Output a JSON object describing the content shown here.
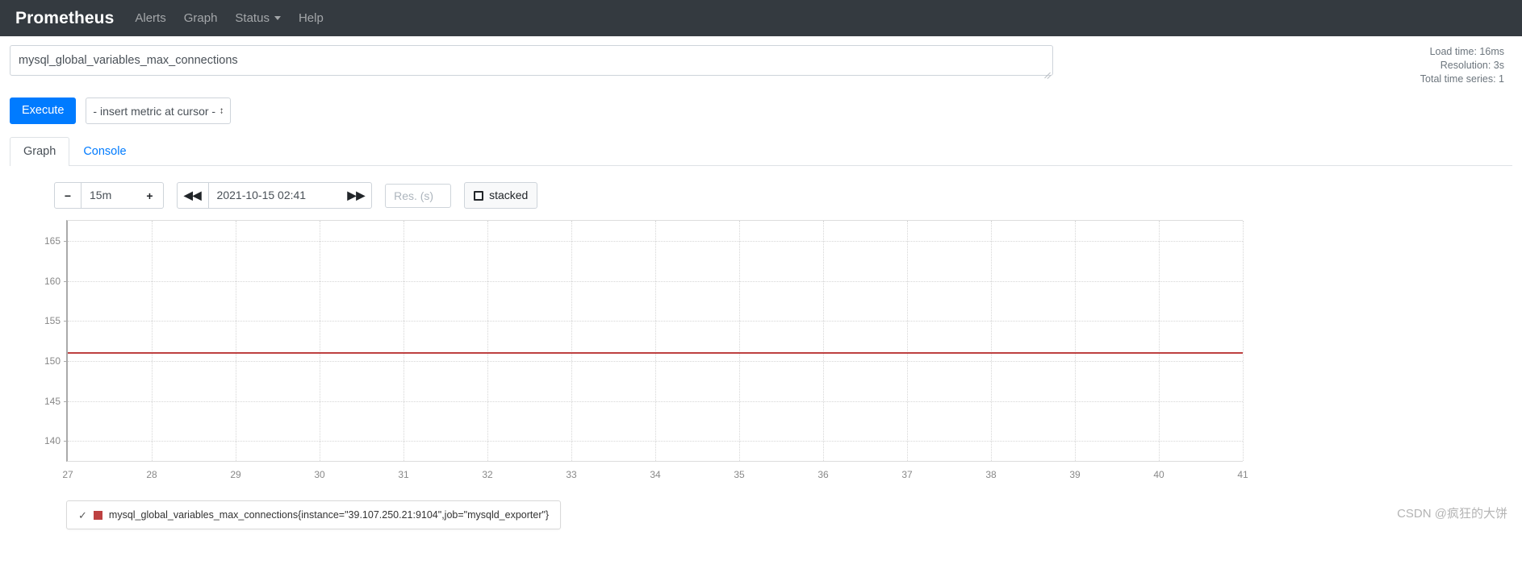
{
  "navbar": {
    "brand": "Prometheus",
    "links": [
      {
        "label": "Alerts",
        "has_caret": false
      },
      {
        "label": "Graph",
        "has_caret": false
      },
      {
        "label": "Status",
        "has_caret": true
      },
      {
        "label": "Help",
        "has_caret": false
      }
    ]
  },
  "query": {
    "expression": "mysql_global_variables_max_connections",
    "execute_label": "Execute",
    "metric_select_value": "- insert metric at cursor -"
  },
  "stats": {
    "load_time": "Load time: 16ms",
    "resolution": "Resolution: 3s",
    "total_series": "Total time series: 1"
  },
  "tabs": [
    {
      "label": "Graph",
      "active": true
    },
    {
      "label": "Console",
      "active": false
    }
  ],
  "graph_controls": {
    "decrease_label": "−",
    "range_value": "15m",
    "increase_label": "+",
    "back_label": "◀◀",
    "time_value": "2021-10-15 02:41",
    "forward_label": "▶▶",
    "resolution_placeholder": "Res. (s)",
    "resolution_value": "",
    "stacked_label": "stacked",
    "stacked_checked": false
  },
  "chart_data": {
    "type": "line",
    "title": "",
    "xlabel": "",
    "ylabel": "",
    "x": [
      27,
      28,
      29,
      30,
      31,
      32,
      33,
      34,
      35,
      36,
      37,
      38,
      39,
      40,
      41
    ],
    "xticklabels": [
      "27",
      "28",
      "29",
      "30",
      "31",
      "32",
      "33",
      "34",
      "35",
      "36",
      "37",
      "38",
      "39",
      "40",
      "41"
    ],
    "yticks": [
      140,
      145,
      150,
      155,
      160,
      165
    ],
    "yticklabels": [
      "140",
      "145",
      "150",
      "155",
      "160",
      "165"
    ],
    "ylim": [
      137.5,
      167.5
    ],
    "grid": true,
    "legend_position": "bottom-left",
    "series": [
      {
        "name": "mysql_global_variables_max_connections{instance=\"39.107.250.21:9104\",job=\"mysqld_exporter\"}",
        "color": "#bd4141",
        "values": [
          151,
          151,
          151,
          151,
          151,
          151,
          151,
          151,
          151,
          151,
          151,
          151,
          151,
          151,
          151
        ]
      }
    ]
  },
  "legend": {
    "check_glyph": "✓",
    "entry": "mysql_global_variables_max_connections{instance=\"39.107.250.21:9104\",job=\"mysqld_exporter\"}"
  },
  "watermark": "CSDN @疯狂的大饼"
}
